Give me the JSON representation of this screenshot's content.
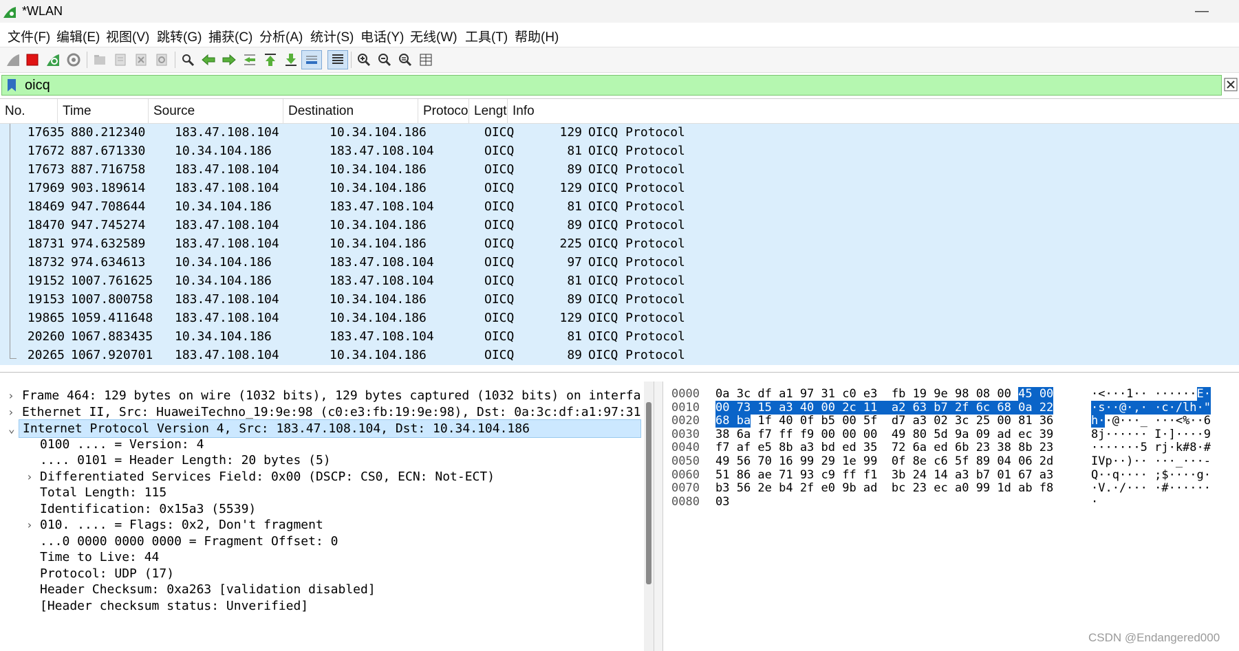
{
  "window": {
    "title": "*WLAN",
    "minimize_glyph": "—"
  },
  "menu": [
    "文件(F)",
    "编辑(E)",
    "视图(V)",
    "跳转(G)",
    "捕获(C)",
    "分析(A)",
    "统计(S)",
    "电话(Y)",
    "无线(W)",
    "工具(T)",
    "帮助(H)"
  ],
  "toolbar": {
    "icons": [
      "shark-fin-start-icon",
      "stop-capture-icon",
      "restart-capture-icon",
      "capture-options-icon",
      "open-file-icon",
      "save-file-icon",
      "close-file-icon",
      "reload-file-icon",
      "find-packet-icon",
      "go-back-icon",
      "go-forward-icon",
      "go-to-packet-icon",
      "go-first-icon",
      "go-last-icon",
      "auto-scroll-icon",
      "colorize-icon",
      "zoom-in-icon",
      "zoom-out-icon",
      "zoom-normal-icon",
      "resize-columns-icon"
    ]
  },
  "filter": {
    "value": "oicq"
  },
  "packet_list": {
    "columns": [
      "No.",
      "Time",
      "Source",
      "Destination",
      "Protocol",
      "Lengtl",
      "Info"
    ],
    "rows": [
      [
        "17635",
        "880.212340",
        "183.47.108.104",
        "10.34.104.186",
        "OICQ",
        "129",
        "OICQ Protocol"
      ],
      [
        "17672",
        "887.671330",
        "10.34.104.186",
        "183.47.108.104",
        "OICQ",
        "81",
        "OICQ Protocol"
      ],
      [
        "17673",
        "887.716758",
        "183.47.108.104",
        "10.34.104.186",
        "OICQ",
        "89",
        "OICQ Protocol"
      ],
      [
        "17969",
        "903.189614",
        "183.47.108.104",
        "10.34.104.186",
        "OICQ",
        "129",
        "OICQ Protocol"
      ],
      [
        "18469",
        "947.708644",
        "10.34.104.186",
        "183.47.108.104",
        "OICQ",
        "81",
        "OICQ Protocol"
      ],
      [
        "18470",
        "947.745274",
        "183.47.108.104",
        "10.34.104.186",
        "OICQ",
        "89",
        "OICQ Protocol"
      ],
      [
        "18731",
        "974.632589",
        "183.47.108.104",
        "10.34.104.186",
        "OICQ",
        "225",
        "OICQ Protocol"
      ],
      [
        "18732",
        "974.634613",
        "10.34.104.186",
        "183.47.108.104",
        "OICQ",
        "97",
        "OICQ Protocol"
      ],
      [
        "19152",
        "1007.761625",
        "10.34.104.186",
        "183.47.108.104",
        "OICQ",
        "81",
        "OICQ Protocol"
      ],
      [
        "19153",
        "1007.800758",
        "183.47.108.104",
        "10.34.104.186",
        "OICQ",
        "89",
        "OICQ Protocol"
      ],
      [
        "19865",
        "1059.411648",
        "183.47.108.104",
        "10.34.104.186",
        "OICQ",
        "129",
        "OICQ Protocol"
      ],
      [
        "20260",
        "1067.883435",
        "10.34.104.186",
        "183.47.108.104",
        "OICQ",
        "81",
        "OICQ Protocol"
      ],
      [
        "20265",
        "1067.920701",
        "183.47.108.104",
        "10.34.104.186",
        "OICQ",
        "89",
        "OICQ Protocol"
      ]
    ]
  },
  "details": [
    {
      "arrow": "›",
      "indent": 0,
      "text": "Frame 464: 129 bytes on wire (1032 bits), 129 bytes captured (1032 bits) on interfa",
      "selected": false
    },
    {
      "arrow": "›",
      "indent": 0,
      "text": "Ethernet II, Src: HuaweiTechno_19:9e:98 (c0:e3:fb:19:9e:98), Dst: 0a:3c:df:a1:97:31",
      "selected": false
    },
    {
      "arrow": "⌄",
      "indent": 0,
      "text": "Internet Protocol Version 4, Src: 183.47.108.104, Dst: 10.34.104.186",
      "selected": true
    },
    {
      "arrow": "",
      "indent": 1,
      "text": "0100 .... = Version: 4",
      "selected": false
    },
    {
      "arrow": "",
      "indent": 1,
      "text": ".... 0101 = Header Length: 20 bytes (5)",
      "selected": false
    },
    {
      "arrow": "›",
      "indent": 1,
      "text": "Differentiated Services Field: 0x00 (DSCP: CS0, ECN: Not-ECT)",
      "selected": false
    },
    {
      "arrow": "",
      "indent": 1,
      "text": "Total Length: 115",
      "selected": false
    },
    {
      "arrow": "",
      "indent": 1,
      "text": "Identification: 0x15a3 (5539)",
      "selected": false
    },
    {
      "arrow": "›",
      "indent": 1,
      "text": "010. .... = Flags: 0x2, Don't fragment",
      "selected": false
    },
    {
      "arrow": "",
      "indent": 1,
      "text": "...0 0000 0000 0000 = Fragment Offset: 0",
      "selected": false
    },
    {
      "arrow": "",
      "indent": 1,
      "text": "Time to Live: 44",
      "selected": false
    },
    {
      "arrow": "",
      "indent": 1,
      "text": "Protocol: UDP (17)",
      "selected": false
    },
    {
      "arrow": "",
      "indent": 1,
      "text": "Header Checksum: 0xa263 [validation disabled]",
      "selected": false
    },
    {
      "arrow": "",
      "indent": 1,
      "text": "[Header checksum status: Unverified]",
      "selected": false
    }
  ],
  "bytes": [
    {
      "offset": "0000",
      "hex": [
        [
          "0a 3c df a1 97 31 c0 e3  fb 19 9e 98 08 00 ",
          false
        ],
        [
          "45 00",
          true
        ]
      ],
      "ascii": [
        [
          "·<···1·· ······",
          false
        ],
        [
          "E·",
          true
        ]
      ]
    },
    {
      "offset": "0010",
      "hex": [
        [
          "00 73 15 a3 40 00 2c 11  a2 63 b7 2f 6c 68 0a 22",
          true
        ]
      ],
      "ascii": [
        [
          "·s··@·,· ·c·/lh·\"",
          true
        ]
      ]
    },
    {
      "offset": "0020",
      "hex": [
        [
          "68 ba",
          true
        ],
        [
          " 1f 40 0f b5 00 5f  d7 a3 02 3c 25 00 81 36",
          false
        ]
      ],
      "ascii": [
        [
          "h·",
          true
        ],
        [
          "·@···_ ···<%··6",
          false
        ]
      ]
    },
    {
      "offset": "0030",
      "hex": [
        [
          "38 6a f7 ff f9 00 00 00  49 80 5d 9a 09 ad ec 39",
          false
        ]
      ],
      "ascii": [
        [
          "8j······ I·]····9",
          false
        ]
      ]
    },
    {
      "offset": "0040",
      "hex": [
        [
          "f7 af e5 8b a3 bd ed 35  72 6a ed 6b 23 38 8b 23",
          false
        ]
      ],
      "ascii": [
        [
          "·······5 rj·k#8·#",
          false
        ]
      ]
    },
    {
      "offset": "0050",
      "hex": [
        [
          "49 56 70 16 99 29 1e 99  0f 8e c6 5f 89 04 06 2d",
          false
        ]
      ],
      "ascii": [
        [
          "IVp··)·· ···_···-",
          false
        ]
      ]
    },
    {
      "offset": "0060",
      "hex": [
        [
          "51 86 ae 71 93 c9 ff f1  3b 24 14 a3 b7 01 67 a3",
          false
        ]
      ],
      "ascii": [
        [
          "Q··q···· ;$····g·",
          false
        ]
      ]
    },
    {
      "offset": "0070",
      "hex": [
        [
          "b3 56 2e b4 2f e0 9b ad  bc 23 ec a0 99 1d ab f8",
          false
        ]
      ],
      "ascii": [
        [
          "·V.·/··· ·#······",
          false
        ]
      ]
    },
    {
      "offset": "0080",
      "hex": [
        [
          "03",
          false
        ]
      ],
      "ascii": [
        [
          "·",
          false
        ]
      ]
    }
  ],
  "watermark": "CSDN @Endangered000",
  "colors": {
    "row_bg": "#dbeefc",
    "filter_bg": "#b5f7b0",
    "byte_highlight": "#0a64c8",
    "selected_detail": "#cce8ff"
  }
}
